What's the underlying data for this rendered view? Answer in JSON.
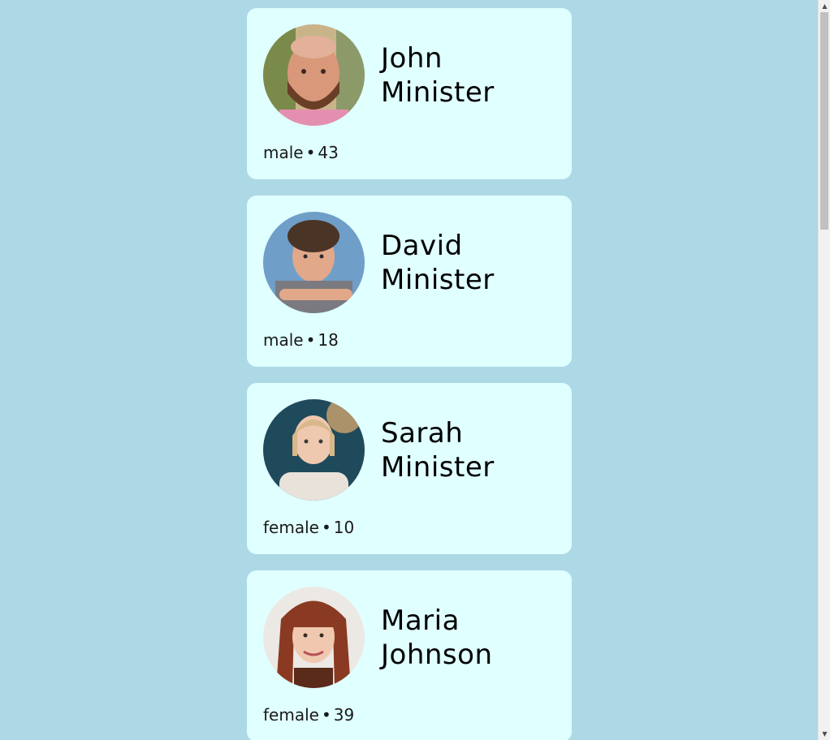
{
  "people": [
    {
      "name": "John Minister",
      "first": "John",
      "last": "Minister",
      "gender": "male",
      "age": "43",
      "photo": "bald-bearded-man"
    },
    {
      "name": "David Minister",
      "first": "David",
      "last": "Minister",
      "gender": "male",
      "age": "18",
      "photo": "curly-haired-teen"
    },
    {
      "name": "Sarah Minister",
      "first": "Sarah",
      "last": "Minister",
      "gender": "female",
      "age": "10",
      "photo": "blonde-girl"
    },
    {
      "name": "Maria Johnson",
      "first": "Maria",
      "last": "Johnson",
      "gender": "female",
      "age": "39",
      "photo": "red-haired-woman"
    }
  ],
  "separator": "•",
  "colors": {
    "background": "#add8e6",
    "card": "#e0ffff"
  },
  "scrollbar": {
    "up_icon": "triangle-up",
    "down_icon": "triangle-down"
  }
}
